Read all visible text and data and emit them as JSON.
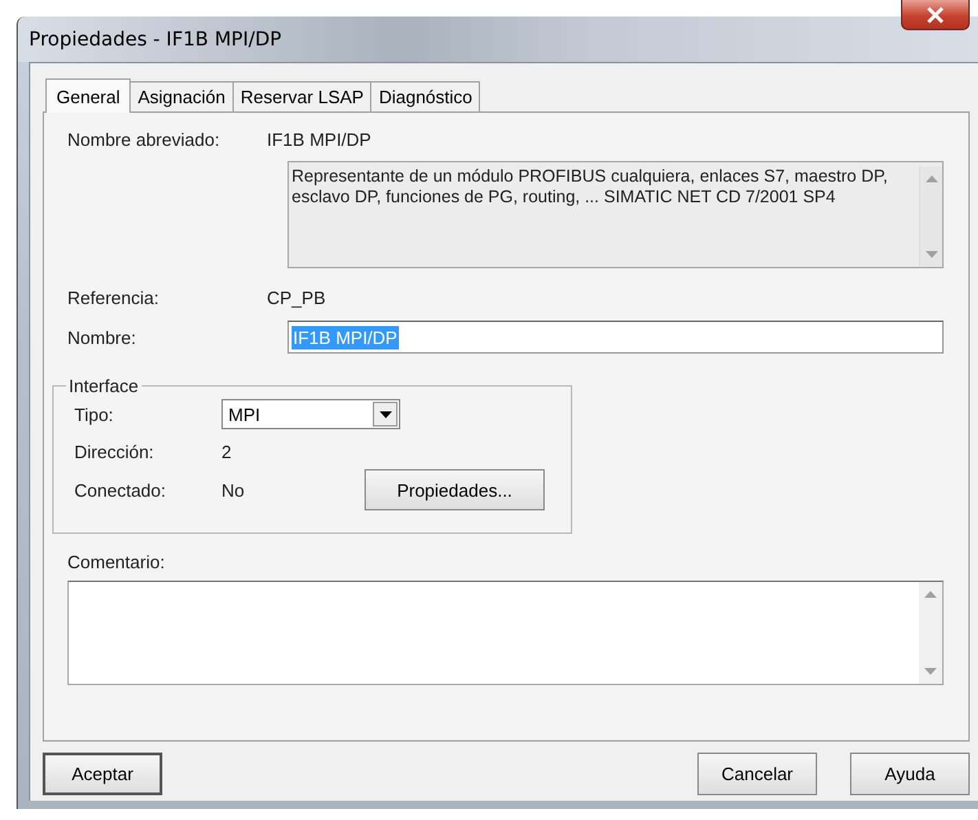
{
  "window": {
    "title": "Propiedades - IF1B MPI/DP"
  },
  "tabs": [
    {
      "label": "General",
      "selected": true
    },
    {
      "label": "Asignación",
      "selected": false
    },
    {
      "label": "Reservar LSAP",
      "selected": false
    },
    {
      "label": "Diagnóstico",
      "selected": false
    }
  ],
  "general": {
    "short_name": {
      "label": "Nombre abreviado:",
      "value": "IF1B MPI/DP"
    },
    "description": "Representante de un módulo PROFIBUS cualquiera, enlaces S7, maestro DP, esclavo DP, funciones de PG, routing, ... SIMATIC NET CD 7/2001 SP4",
    "reference": {
      "label": "Referencia:",
      "value": "CP_PB"
    },
    "name": {
      "label": "Nombre:",
      "value": "IF1B MPI/DP",
      "text_selected": true
    }
  },
  "interface": {
    "title": "Interface",
    "type": {
      "label": "Tipo:",
      "value": "MPI"
    },
    "address": {
      "label": "Dirección:",
      "value": "2"
    },
    "connected": {
      "label": "Conectado:",
      "value": "No"
    },
    "properties_button": "Propiedades..."
  },
  "comment": {
    "label": "Comentario:"
  },
  "buttons": [
    {
      "label": "Aceptar",
      "default": true
    },
    {
      "label": "Cancelar",
      "default": false
    },
    {
      "label": "Ayuda",
      "default": false
    }
  ]
}
